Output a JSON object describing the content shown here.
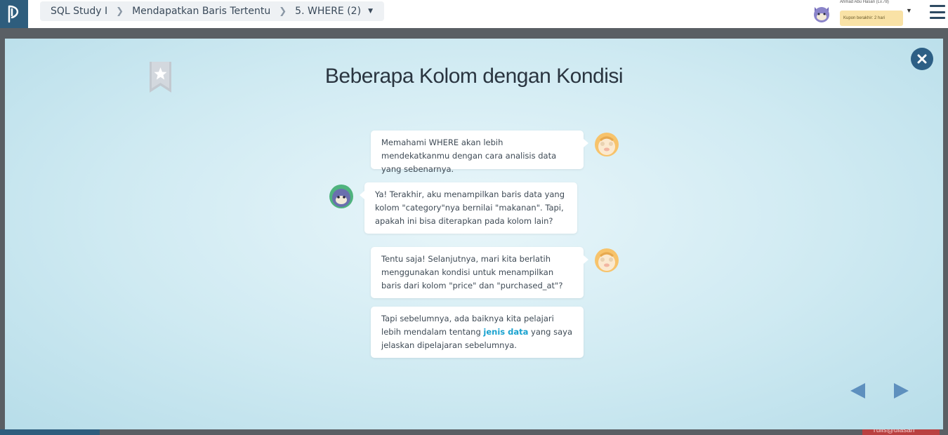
{
  "breadcrumb": {
    "course": "SQL Study I",
    "section": "Mendapatkan Baris Tertentu",
    "lesson": "5. WHERE (2)"
  },
  "user": {
    "name": "Ahmad Abu Hasan (Lv.78)",
    "coupon": "Kupon berakhir: 2 hari"
  },
  "background": {
    "bottom_right_text": "Tulis@ulasan"
  },
  "slide": {
    "title": "Beberapa Kolom dengan Kondisi",
    "messages": [
      {
        "speaker": "teacher",
        "text": "Memahami WHERE akan lebih mendekatkanmu dengan cara analisis data yang sebenarnya."
      },
      {
        "speaker": "student",
        "text": "Ya! Terakhir, aku menampilkan baris data yang kolom \"category\"nya bernilai \"makanan\". Tapi, apakah ini bisa diterapkan pada kolom lain?"
      },
      {
        "speaker": "teacher",
        "text": "Tentu saja! Selanjutnya, mari kita berlatih menggunakan kondisi untuk menampilkan baris dari kolom \"price\" dan \"purchased_at\"?"
      },
      {
        "speaker": "teacher",
        "text_before": "Tapi sebelumnya, ada baiknya kita pelajari lebih mendalam tentang ",
        "link": "jenis data",
        "text_after": " yang saya jelaskan dipelajaran sebelumnya."
      }
    ]
  },
  "icons": {
    "logo": "progate-logo-icon",
    "menu": "hamburger-menu-icon",
    "close": "close-icon",
    "bookmark": "bookmark-star-icon",
    "prev": "arrow-left-icon",
    "next": "arrow-right-icon"
  },
  "colors": {
    "brand": "#2e5d7d",
    "link": "#1aa2cf",
    "coupon_bg": "#f9e2a6"
  }
}
